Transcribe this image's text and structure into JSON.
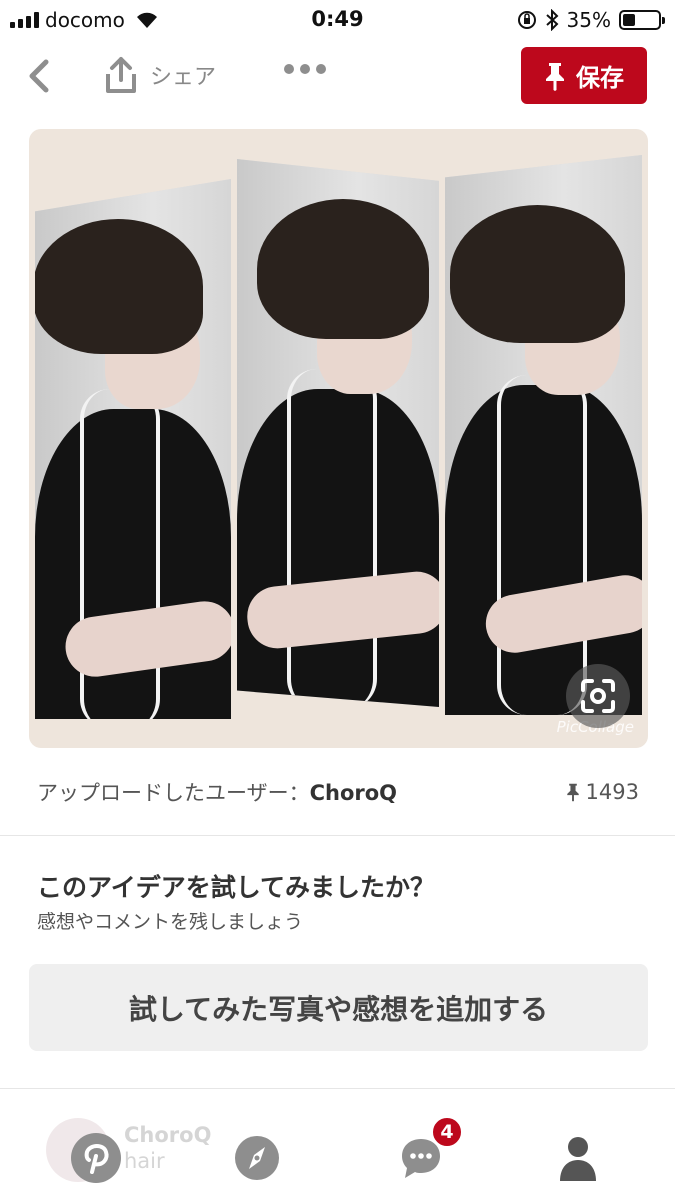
{
  "status_bar": {
    "carrier": "docomo",
    "time": "0:49",
    "battery_percent": "35%",
    "battery_level": 0.35
  },
  "toolbar": {
    "share_label": "シェア",
    "save_label": "保存"
  },
  "pin": {
    "watermark": "PicCollage"
  },
  "uploader": {
    "prefix": "アップロードしたユーザー：",
    "name": "ChoroQ",
    "pin_count": "1493"
  },
  "tried": {
    "title": "このアイデアを試してみましたか？",
    "subtitle": "感想やコメントを残しましょう",
    "button_label": "試してみた写真や感想を追加する"
  },
  "comment_preview": {
    "user": "ChoroQ",
    "text": "hair"
  },
  "tab_bar": {
    "notifications_badge": "4"
  },
  "colors": {
    "brand_red": "#bd081c",
    "icon_gray": "#8e8e8e"
  }
}
